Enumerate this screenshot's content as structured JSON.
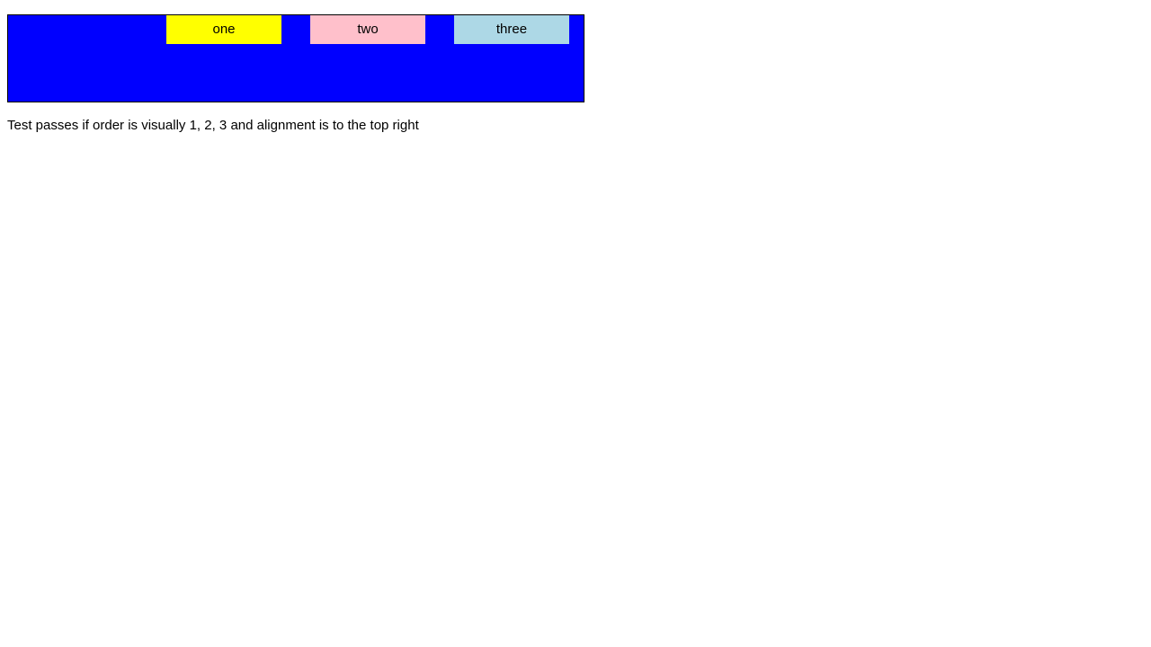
{
  "flex_container": {
    "background_color": "#0000ff",
    "items": [
      {
        "label": "one",
        "color": "#ffff00"
      },
      {
        "label": "two",
        "color": "#ffc0cb"
      },
      {
        "label": "three",
        "color": "#add8e6"
      }
    ]
  },
  "note": {
    "text": "Test passes if order is visually 1, 2, 3 and alignment is to the top right"
  }
}
